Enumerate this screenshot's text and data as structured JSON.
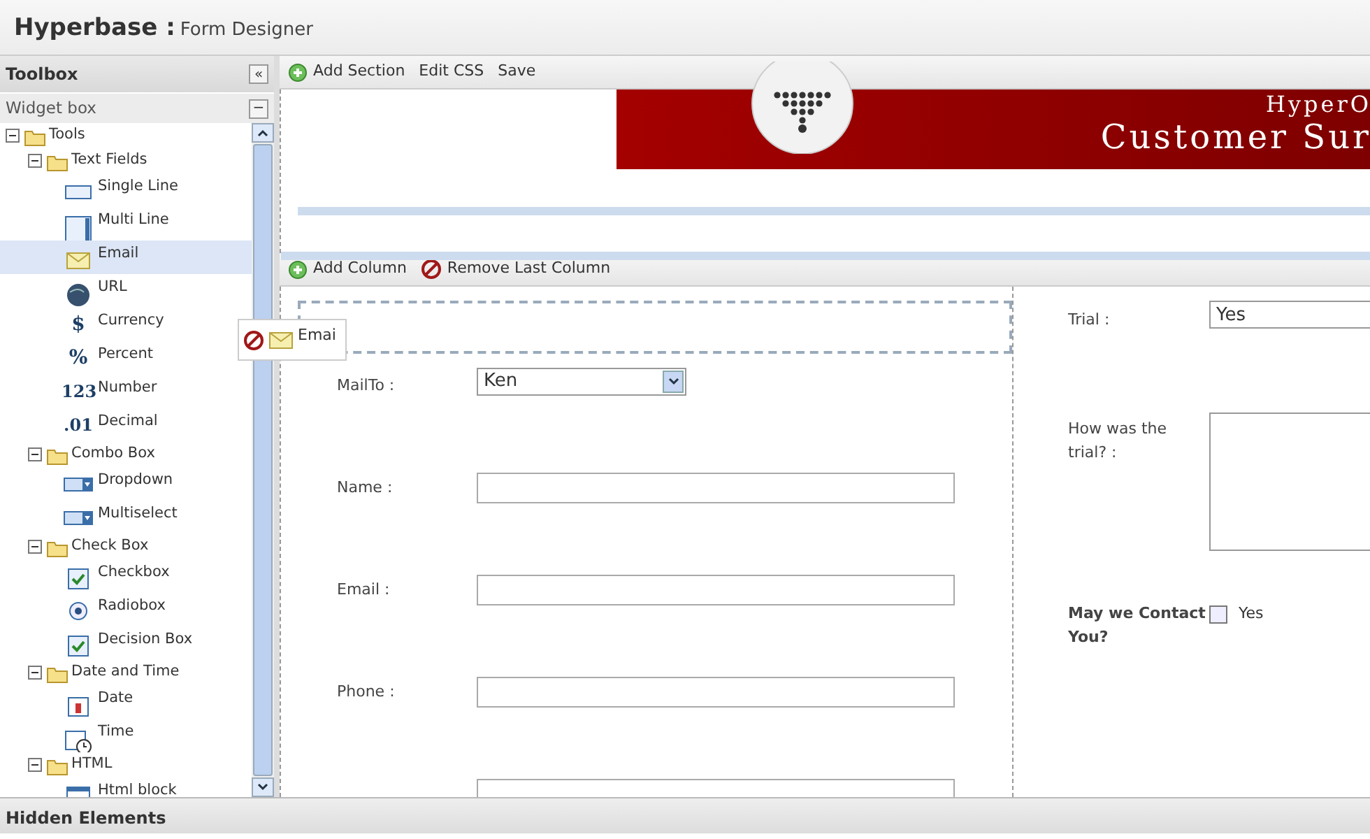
{
  "header": {
    "app": "Hyperbase :",
    "subtitle": "Form Designer"
  },
  "toolbox": {
    "title": "Toolbox",
    "collapse_glyph": "«",
    "widget_box": "Widget box",
    "widget_toggle": "−",
    "tree": [
      {
        "label": "Tools",
        "kind": "folder",
        "expanded": true,
        "children": [
          {
            "label": "Text Fields",
            "kind": "folder",
            "expanded": true,
            "children": [
              {
                "label": "Single Line",
                "kind": "single-line",
                "selected": false
              },
              {
                "label": "Multi Line",
                "kind": "multi-line",
                "selected": false
              },
              {
                "label": "Email",
                "kind": "email",
                "selected": true
              },
              {
                "label": "URL",
                "kind": "url",
                "selected": false
              },
              {
                "label": "Currency",
                "kind": "glyph",
                "glyph": "$",
                "selected": false
              },
              {
                "label": "Percent",
                "kind": "glyph",
                "glyph": "%",
                "selected": false
              },
              {
                "label": "Number",
                "kind": "glyph",
                "glyph": "123",
                "selected": false
              },
              {
                "label": "Decimal",
                "kind": "glyph",
                "glyph": ".01",
                "selected": false
              }
            ]
          },
          {
            "label": "Combo Box",
            "kind": "folder",
            "expanded": true,
            "children": [
              {
                "label": "Dropdown",
                "kind": "dropdown",
                "selected": false
              },
              {
                "label": "Multiselect",
                "kind": "dropdown",
                "selected": false
              }
            ]
          },
          {
            "label": "Check Box",
            "kind": "folder",
            "expanded": true,
            "children": [
              {
                "label": "Checkbox",
                "kind": "checkbox",
                "selected": false
              },
              {
                "label": "Radiobox",
                "kind": "radio",
                "selected": false
              },
              {
                "label": "Decision Box",
                "kind": "checkbox",
                "selected": false
              }
            ]
          },
          {
            "label": "Date and Time",
            "kind": "folder",
            "expanded": true,
            "children": [
              {
                "label": "Date",
                "kind": "date",
                "selected": false
              },
              {
                "label": "Time",
                "kind": "time",
                "selected": false
              }
            ]
          },
          {
            "label": "HTML",
            "kind": "folder",
            "expanded": true,
            "children": [
              {
                "label": "Html block",
                "kind": "html",
                "selected": false
              }
            ]
          }
        ]
      }
    ]
  },
  "section_toolbar": [
    "Add Section",
    "Edit CSS",
    "Save"
  ],
  "banner": {
    "company": "HyperO",
    "title": "Customer Sur"
  },
  "column_toolbar": [
    {
      "label": "Add Column",
      "kind": "add"
    },
    {
      "label": "Remove Last Column",
      "kind": "remove"
    }
  ],
  "drag_item": {
    "label": "Emai"
  },
  "left_fields": [
    {
      "label": "MailTo :",
      "kind": "select",
      "value": "Ken"
    },
    {
      "label": "Name :",
      "kind": "text"
    },
    {
      "label": "Email :",
      "kind": "text"
    },
    {
      "label": "Phone :",
      "kind": "text"
    },
    {
      "kind": "text"
    }
  ],
  "right_fields": [
    {
      "label": "Trial :",
      "kind": "select",
      "value": "Yes"
    },
    {
      "label": "How was the trial? :",
      "kind": "textarea"
    },
    {
      "label": "May we Contact You?",
      "kind": "checkbox",
      "option": "Yes",
      "checked": false
    }
  ],
  "footer": "Hidden Elements"
}
